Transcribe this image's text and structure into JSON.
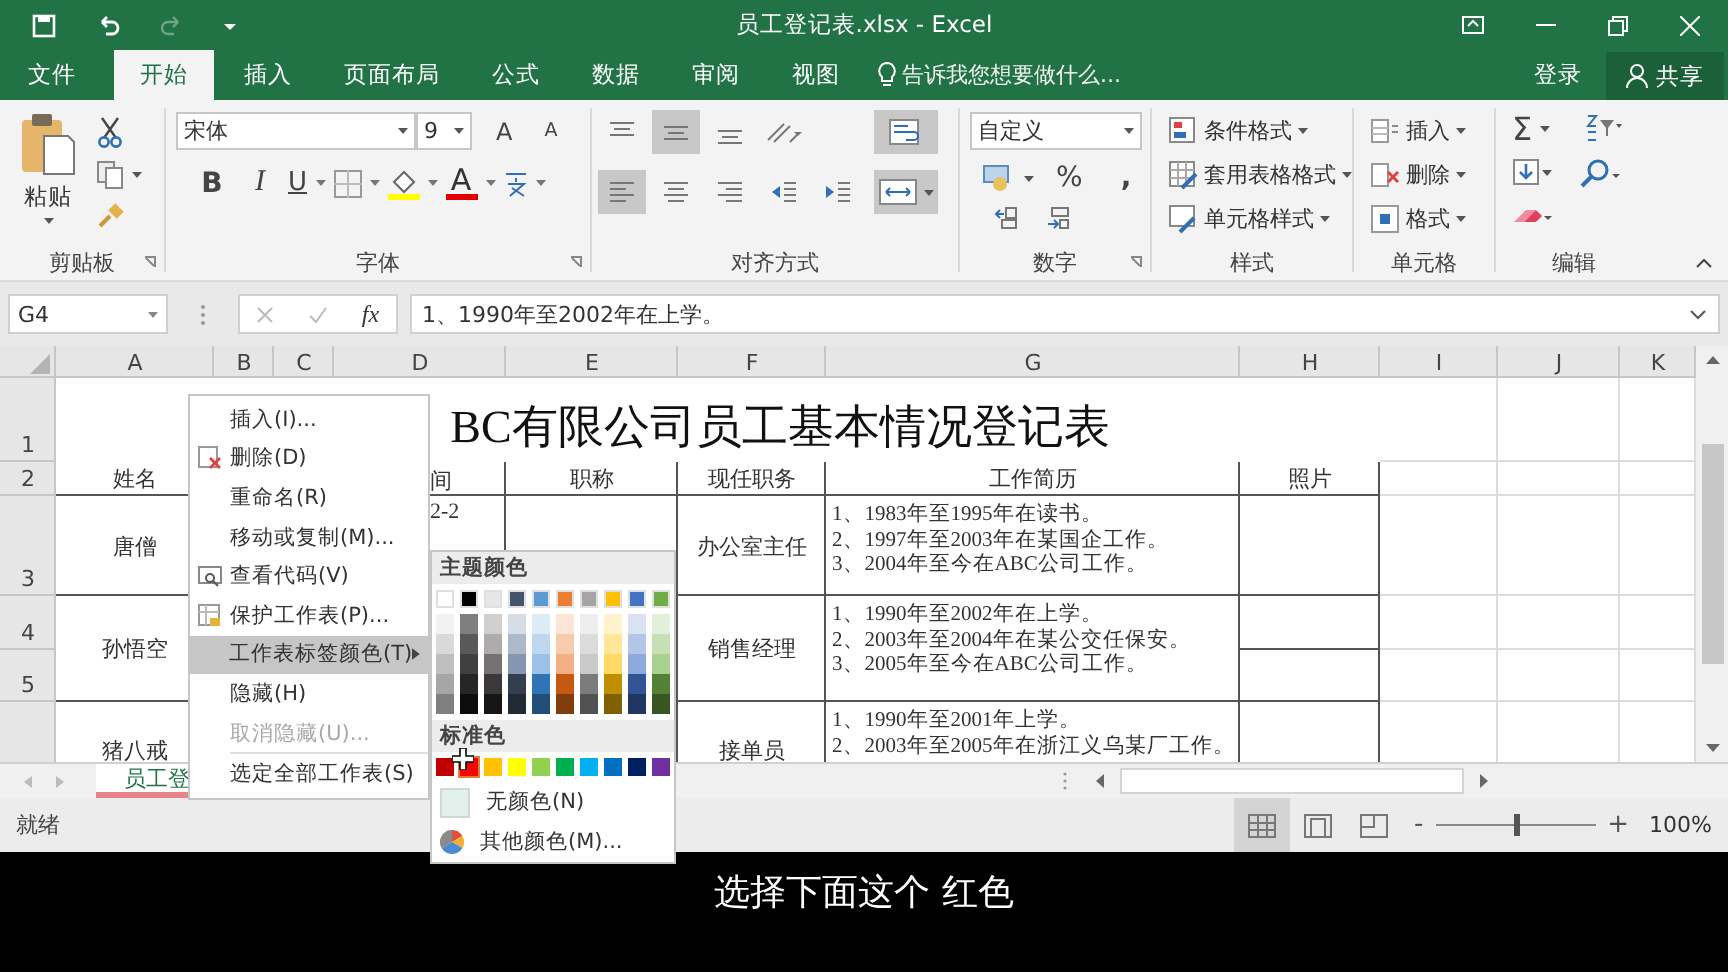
{
  "window": {
    "title": "员工登记表.xlsx - Excel"
  },
  "ribbon_tabs": [
    {
      "label": "文件",
      "selected": false
    },
    {
      "label": "开始",
      "selected": true
    },
    {
      "label": "插入",
      "selected": false
    },
    {
      "label": "页面布局",
      "selected": false
    },
    {
      "label": "公式",
      "selected": false
    },
    {
      "label": "数据",
      "selected": false
    },
    {
      "label": "审阅",
      "selected": false
    },
    {
      "label": "视图",
      "selected": false
    }
  ],
  "tell_me": {
    "placeholder": "告诉我您想要做什么..."
  },
  "sign_in": "登录",
  "share": "共享",
  "clipboard": {
    "paste": "粘贴",
    "label": "剪贴板"
  },
  "font": {
    "name": "宋体",
    "size": "9",
    "grow": "A",
    "shrink": "A",
    "bold": "B",
    "italic": "I",
    "underline": "U",
    "color_letter": "A",
    "label": "字体"
  },
  "alignment": {
    "top_row": [
      {
        "kind": "top",
        "pressed": false
      },
      {
        "kind": "middle",
        "pressed": true
      },
      {
        "kind": "bottom",
        "pressed": false
      },
      {
        "kind": "orientation",
        "pressed": false
      }
    ],
    "bottom_row": [
      {
        "kind": "left",
        "pressed": true
      },
      {
        "kind": "center",
        "pressed": false
      },
      {
        "kind": "right",
        "pressed": false
      },
      {
        "kind": "outdent",
        "pressed": false
      },
      {
        "kind": "indent",
        "pressed": false
      }
    ],
    "wrap_pressed": true,
    "merge_pressed": true,
    "label": "对齐方式"
  },
  "number": {
    "format": "自定义",
    "percent": "%",
    "comma": ",",
    "label": "数字"
  },
  "styles": {
    "items": [
      {
        "kind": "conditional",
        "label": "条件格式"
      },
      {
        "kind": "table",
        "label": "套用表格格式"
      },
      {
        "kind": "cell",
        "label": "单元格样式"
      }
    ],
    "label": "样式"
  },
  "cell_tools": {
    "items": [
      {
        "kind": "insert",
        "label": "插入"
      },
      {
        "kind": "delete",
        "label": "删除"
      },
      {
        "kind": "format",
        "label": "格式"
      }
    ],
    "label": "单元格"
  },
  "editing": {
    "sum": "Σ",
    "label": "编辑"
  },
  "formula_bar": {
    "name_box": "G4",
    "fx": "fx",
    "value": "1、1990年至2002年在上学。"
  },
  "columns": [
    "A",
    "B",
    "C",
    "D",
    "E",
    "F",
    "G",
    "H",
    "I",
    "J",
    "K"
  ],
  "rows": [
    "1",
    "2",
    "3",
    "4",
    "5"
  ],
  "cells": [
    {
      "kind": "title",
      "text": "BC有限公司员工基本情况登记表"
    },
    {
      "kind": "center",
      "text": "姓名"
    },
    {
      "kind": "partial",
      "text": "间"
    },
    {
      "kind": "center",
      "text": "职称"
    },
    {
      "kind": "center",
      "text": "现任职务"
    },
    {
      "kind": "center",
      "text": "工作简历"
    },
    {
      "kind": "center",
      "text": "照片"
    },
    {
      "kind": "center",
      "text": "唐僧"
    },
    {
      "kind": "partial",
      "text": "2-2"
    },
    {
      "kind": "center",
      "text": "办公室主任"
    },
    {
      "kind": "history",
      "text": "1、1983年至1995年在读书。\n2、1997年至2003年在某国企工作。\n3、2004年至今在ABC公司工作。"
    },
    {
      "kind": "center",
      "text": "孙悟空"
    },
    {
      "kind": "center",
      "text": "销售经理"
    },
    {
      "kind": "history",
      "text": "1、1990年至2002年在上学。\n2、2003年至2004年在某公交任保安。\n3、2005年至今在ABC公司工作。"
    },
    {
      "kind": "center",
      "text": "猪八戒"
    },
    {
      "kind": "center",
      "text": "接单员"
    },
    {
      "kind": "history",
      "text": "1、1990年至2001年上学。\n2、2003年至2005年在浙江义乌某厂工作。"
    }
  ],
  "sheet_tabs": [
    {
      "label": "员工登",
      "selected": true
    }
  ],
  "status": "就绪",
  "zoom": {
    "level": 0.5,
    "minus": "-",
    "plus": "+",
    "value": "100%"
  },
  "context_menu": [
    {
      "kind": "plain",
      "label": "插入(I)...",
      "disabled": false,
      "selected": false
    },
    {
      "kind": "delete",
      "label": "删除(D)",
      "disabled": false,
      "selected": false
    },
    {
      "kind": "plain",
      "label": "重命名(R)",
      "disabled": false,
      "selected": false
    },
    {
      "kind": "plain",
      "label": "移动或复制(M)...",
      "disabled": false,
      "selected": false
    },
    {
      "kind": "code",
      "label": "查看代码(V)",
      "disabled": false,
      "selected": false
    },
    {
      "kind": "protect",
      "label": "保护工作表(P)...",
      "disabled": false,
      "selected": false
    },
    {
      "kind": "submenu",
      "label": "工作表标签颜色(T)",
      "disabled": false,
      "selected": true
    },
    {
      "kind": "plain",
      "label": "隐藏(H)",
      "disabled": false,
      "selected": false
    },
    {
      "kind": "plain",
      "label": "取消隐藏(U)...",
      "disabled": true,
      "selected": false
    },
    {
      "kind": "plain",
      "label": "选定全部工作表(S)",
      "disabled": false,
      "selected": false,
      "separator": true
    }
  ],
  "tab_color_menu": {
    "theme_heading": "主题颜色",
    "theme_colors": [
      {
        "color": "#ffffff",
        "shades": [
          {
            "color": "#f2f2f2"
          },
          {
            "color": "#d9d9d9"
          },
          {
            "color": "#bfbfbf"
          },
          {
            "color": "#a6a6a6"
          },
          {
            "color": "#808080"
          }
        ]
      },
      {
        "color": "#000000",
        "shades": [
          {
            "color": "#7f7f7f"
          },
          {
            "color": "#595959"
          },
          {
            "color": "#404040"
          },
          {
            "color": "#262626"
          },
          {
            "color": "#0d0d0d"
          }
        ]
      },
      {
        "color": "#e7e6e6",
        "shades": [
          {
            "color": "#d0cece"
          },
          {
            "color": "#aeabab"
          },
          {
            "color": "#757171"
          },
          {
            "color": "#3a3838"
          },
          {
            "color": "#171616"
          }
        ]
      },
      {
        "color": "#44546a",
        "shades": [
          {
            "color": "#d6dce4"
          },
          {
            "color": "#adb9ca"
          },
          {
            "color": "#8497b0"
          },
          {
            "color": "#333f4f"
          },
          {
            "color": "#222a35"
          }
        ]
      },
      {
        "color": "#5b9bd5",
        "shades": [
          {
            "color": "#ddebf7"
          },
          {
            "color": "#bdd7ee"
          },
          {
            "color": "#9bc2e6"
          },
          {
            "color": "#2f75b5"
          },
          {
            "color": "#1f4e78"
          }
        ]
      },
      {
        "color": "#ed7d31",
        "shades": [
          {
            "color": "#fce4d6"
          },
          {
            "color": "#f8cbad"
          },
          {
            "color": "#f4b084"
          },
          {
            "color": "#c65911"
          },
          {
            "color": "#833c0c"
          }
        ]
      },
      {
        "color": "#a5a5a5",
        "shades": [
          {
            "color": "#ededed"
          },
          {
            "color": "#dbdbdb"
          },
          {
            "color": "#c9c9c9"
          },
          {
            "color": "#7b7b7b"
          },
          {
            "color": "#525252"
          }
        ]
      },
      {
        "color": "#ffc000",
        "shades": [
          {
            "color": "#fff2cc"
          },
          {
            "color": "#ffe699"
          },
          {
            "color": "#ffd966"
          },
          {
            "color": "#bf8f00"
          },
          {
            "color": "#806000"
          }
        ]
      },
      {
        "color": "#4472c4",
        "shades": [
          {
            "color": "#d9e1f2"
          },
          {
            "color": "#b4c6e7"
          },
          {
            "color": "#8ea9db"
          },
          {
            "color": "#305496"
          },
          {
            "color": "#203764"
          }
        ]
      },
      {
        "color": "#70ad47",
        "shades": [
          {
            "color": "#e2efda"
          },
          {
            "color": "#c6e0b4"
          },
          {
            "color": "#a9d08e"
          },
          {
            "color": "#548235"
          },
          {
            "color": "#375623"
          }
        ]
      }
    ],
    "standard_heading": "标准色",
    "standard_colors": [
      {
        "color": "#c00000",
        "selected": false
      },
      {
        "color": "#ff0000",
        "selected": true
      },
      {
        "color": "#ffc000",
        "selected": false
      },
      {
        "color": "#ffff00",
        "selected": false
      },
      {
        "color": "#92d050",
        "selected": false
      },
      {
        "color": "#00b050",
        "selected": false
      },
      {
        "color": "#00b0f0",
        "selected": false
      },
      {
        "color": "#0070c0",
        "selected": false
      },
      {
        "color": "#002060",
        "selected": false
      },
      {
        "color": "#7030a0",
        "selected": false
      }
    ],
    "no_color": "无颜色(N)",
    "more_colors": "其他颜色(M)..."
  },
  "caption": "选择下面这个 红色"
}
